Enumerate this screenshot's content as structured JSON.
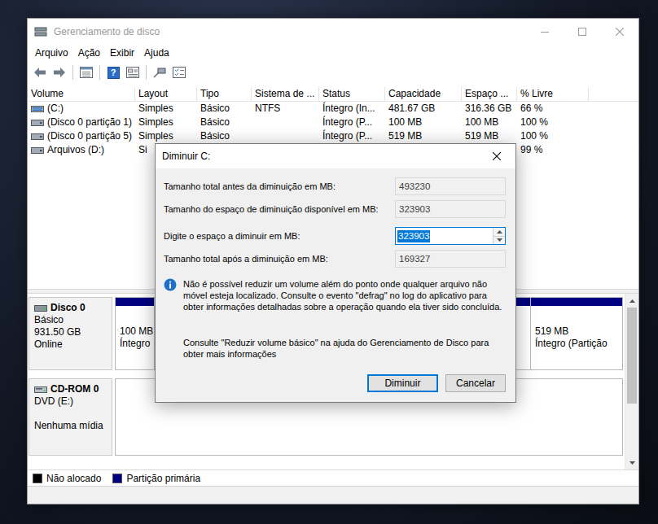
{
  "window": {
    "title": "Gerenciamento de disco",
    "active": false
  },
  "menu": [
    "Arquivo",
    "Ação",
    "Exibir",
    "Ajuda"
  ],
  "toolbar": {
    "help_glyph": "?"
  },
  "table": {
    "columns": [
      "Volume",
      "Layout",
      "Tipo",
      "Sistema de ...",
      "Status",
      "Capacidade",
      "Espaço ...",
      "% Livre"
    ],
    "rows": [
      {
        "kind": "boot",
        "cells": [
          "(C:)",
          "Simples",
          "Básico",
          "NTFS",
          "Íntegro (In...",
          "481.67 GB",
          "316.36 GB",
          "66 %"
        ]
      },
      {
        "kind": "volume",
        "cells": [
          "(Disco 0 partição 1)",
          "Simples",
          "Básico",
          "",
          "Íntegro (P...",
          "100 MB",
          "100 MB",
          "100 %"
        ]
      },
      {
        "kind": "volume",
        "cells": [
          "(Disco 0 partição 5)",
          "Simples",
          "Básico",
          "",
          "Íntegro (P...",
          "519 MB",
          "519 MB",
          "100 %"
        ]
      },
      {
        "kind": "volume",
        "cells": [
          "Arquivos (D:)",
          "Si",
          "",
          "",
          "",
          "",
          "",
          "99 %"
        ]
      }
    ]
  },
  "disks": [
    {
      "kind": "disk",
      "name": "Disco 0",
      "type": "Básico",
      "size": "931.50 GB",
      "status": "Online",
      "partitions": [
        {
          "size": "100 MB",
          "status": "Íntegro",
          "color": "#000080"
        },
        {
          "size": "519 MB",
          "status": "Íntegro (Partição",
          "color": "#000080"
        }
      ]
    },
    {
      "kind": "cdrom",
      "name": "CD-ROM 0",
      "type": "DVD (E:)",
      "status": "Nenhuma mídia",
      "partitions": []
    }
  ],
  "legend": [
    {
      "label": "Não alocado",
      "color": "#000000"
    },
    {
      "label": "Partição primária",
      "color": "#000080"
    }
  ],
  "dialog": {
    "title": "Diminuir C:",
    "active": true,
    "fields": [
      {
        "kind": "readonly",
        "label": "Tamanho total antes da diminuição em MB:",
        "value": "493230",
        "focused": false,
        "text_selected": false
      },
      {
        "kind": "readonly",
        "label": "Tamanho do espaço de diminuição disponível em MB:",
        "value": "323903",
        "focused": false,
        "text_selected": false
      },
      {
        "kind": "spin",
        "label": "Digite o espaço a diminuir em MB:",
        "value": "323903",
        "focused": true,
        "text_selected": true
      },
      {
        "kind": "readonly",
        "label": "Tamanho total após a diminuição em MB:",
        "value": "169327",
        "focused": false,
        "text_selected": false
      }
    ],
    "note": "Não é possível reduzir um volume além do ponto onde qualquer arquivo não móvel esteja localizado. Consulte o evento \"defrag\" no log do aplicativo para obter informações detalhadas sobre a operação quando ela tiver sido concluída.",
    "help": "Consulte \"Reduzir volume básico\" na ajuda do Gerenciamento de Disco para obter mais informações",
    "buttons": [
      {
        "label": "Diminuir",
        "default": true
      },
      {
        "label": "Cancelar",
        "default": false
      }
    ]
  }
}
